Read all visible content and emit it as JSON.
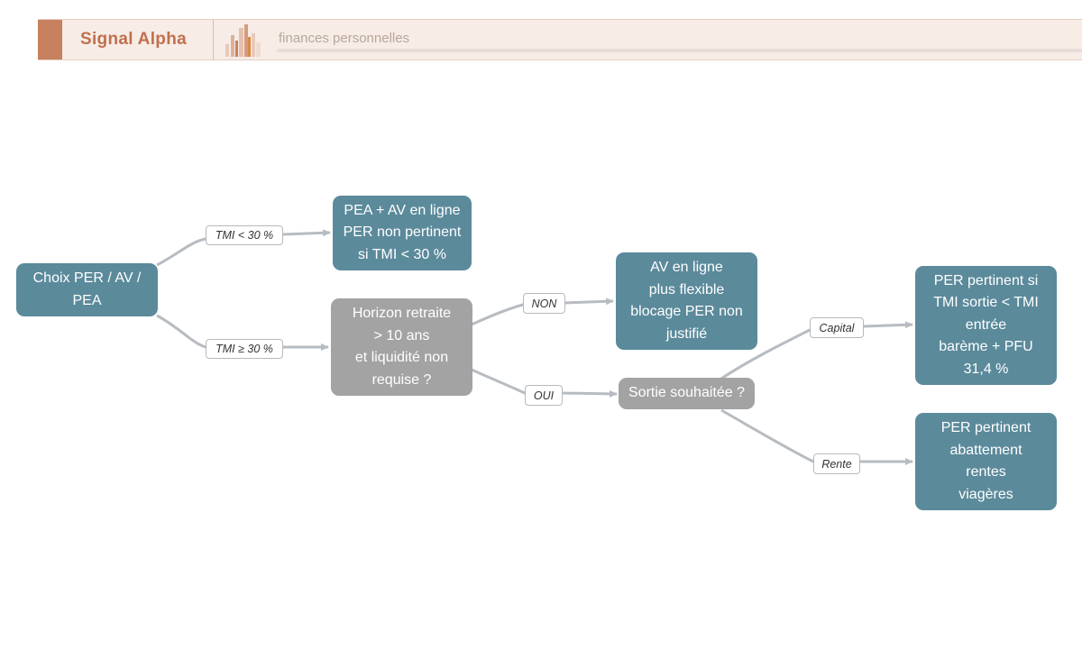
{
  "header": {
    "brand": "Signal Alpha",
    "subtitle": "finances personnelles"
  },
  "colors": {
    "teal_node": "#5b8a9b",
    "gray_node": "#a3a3a3",
    "edge": "#b7bcc2",
    "brand": "#c0704d"
  },
  "nodes": {
    "root": "Choix PER / AV /\nPEA",
    "pea_av": "PEA + AV en ligne\nPER non pertinent\nsi TMI < 30 %",
    "horizon": "Horizon retraite\n> 10 ans\net liquidité non\nrequise ?",
    "av_flex": "AV en ligne\nplus flexible\nblocage PER non\njustifié",
    "sortie": "Sortie souhaitée ?",
    "per_capital": "PER pertinent si\nTMI sortie < TMI\nentrée\nbarème + PFU\n31,4 %",
    "per_rente": "PER pertinent\nabattement\nrentes\nviagères"
  },
  "edges": {
    "tmi_low": "TMI < 30 %",
    "tmi_high": "TMI ≥ 30 %",
    "non": "NON",
    "oui": "OUI",
    "capital": "Capital",
    "rente": "Rente"
  }
}
